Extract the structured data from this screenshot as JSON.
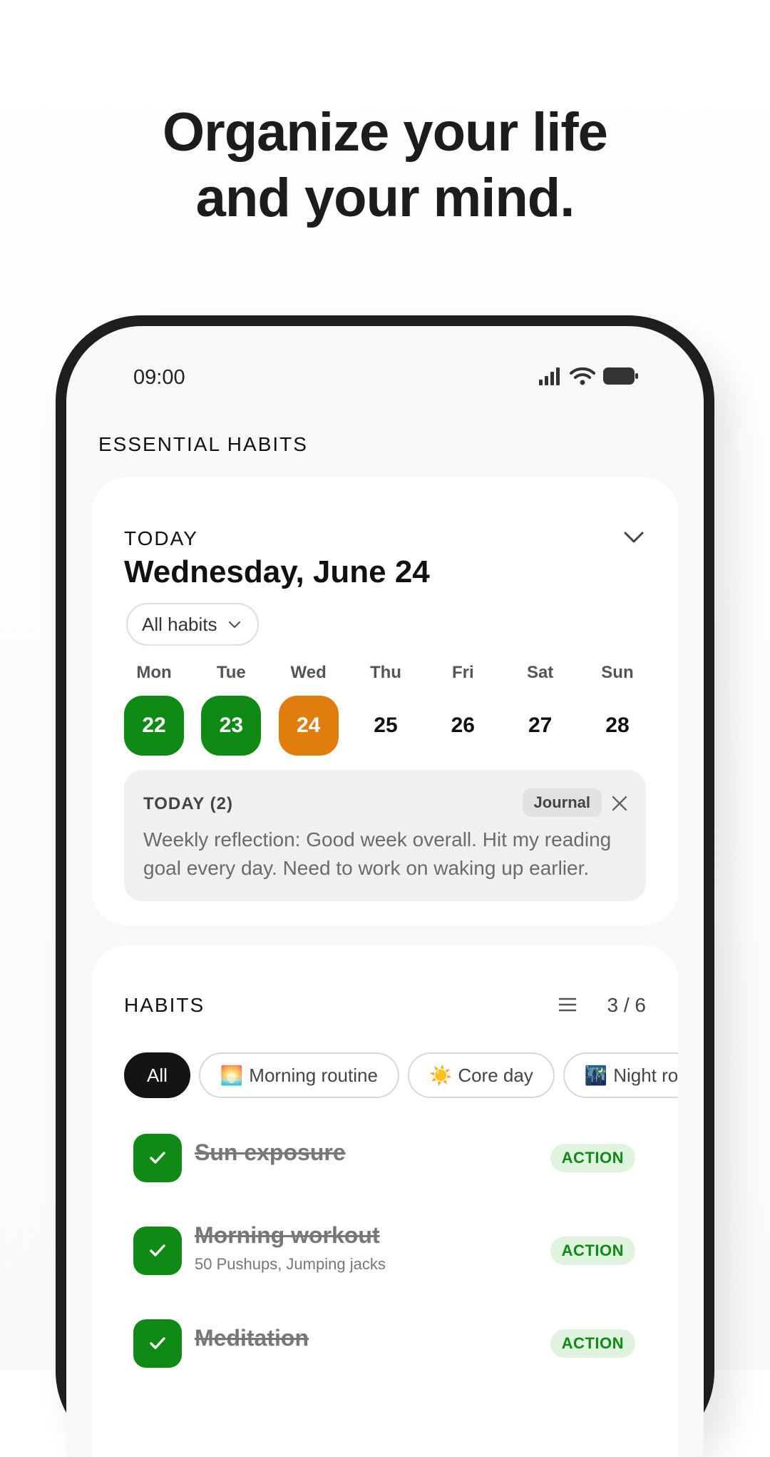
{
  "headline": [
    "Organize your life",
    "and your mind."
  ],
  "status_bar": {
    "time": "09:00",
    "icons": [
      "signal-icon",
      "wifi-icon",
      "battery-icon"
    ]
  },
  "section_title": "ESSENTIAL HABITS",
  "today_card": {
    "label": "TODAY",
    "date": "Wednesday, June 24",
    "filter": "All habits",
    "week": [
      {
        "name": "Mon",
        "num": "22",
        "state": "done"
      },
      {
        "name": "Tue",
        "num": "23",
        "state": "done"
      },
      {
        "name": "Wed",
        "num": "24",
        "state": "today"
      },
      {
        "name": "Thu",
        "num": "25",
        "state": "none"
      },
      {
        "name": "Fri",
        "num": "26",
        "state": "none"
      },
      {
        "name": "Sat",
        "num": "27",
        "state": "none"
      },
      {
        "name": "Sun",
        "num": "28",
        "state": "none"
      }
    ],
    "journal": {
      "header": "TODAY (2)",
      "tag": "Journal",
      "text": "Weekly reflection: Good week overall. Hit my reading goal every day. Need to work on waking up earlier."
    }
  },
  "habits": {
    "title": "HABITS",
    "count": "3 / 6",
    "chips": [
      {
        "label": "All",
        "emoji": ""
      },
      {
        "label": "Morning routine",
        "emoji": "🌅"
      },
      {
        "label": "Core day",
        "emoji": "☀️"
      },
      {
        "label": "Night routine",
        "emoji": "🌃"
      }
    ],
    "items": [
      {
        "name": "Sun exposure",
        "sub": "",
        "tag": "ACTION"
      },
      {
        "name": "Morning workout",
        "sub": "50 Pushups, Jumping jacks",
        "tag": "ACTION"
      },
      {
        "name": "Meditation",
        "sub": "",
        "tag": "ACTION"
      }
    ]
  },
  "colors": {
    "done": "#0f8a14",
    "today": "#e17d0c",
    "action_bg": "#dff3df"
  }
}
